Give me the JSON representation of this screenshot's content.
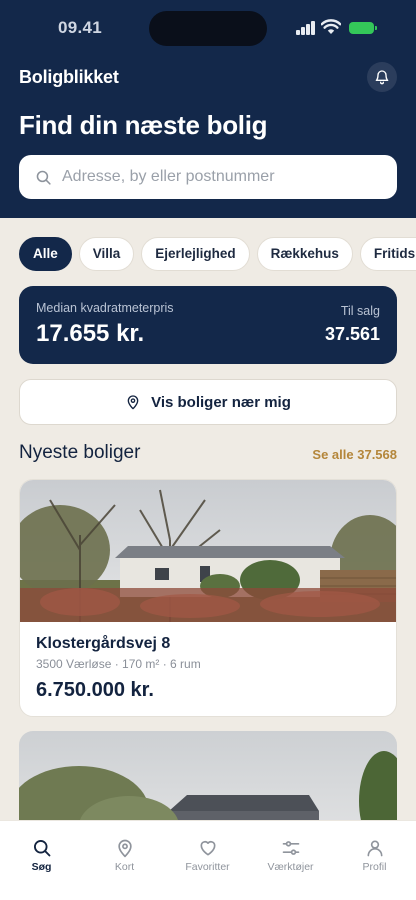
{
  "status_bar": {
    "time": "09.41"
  },
  "header": {
    "brand": "Boligblikket",
    "headline": "Find din næste bolig",
    "search_placeholder": "Adresse, by eller postnummer"
  },
  "filters": [
    {
      "label": "Alle",
      "active": true
    },
    {
      "label": "Villa",
      "active": false
    },
    {
      "label": "Ejerlejlighed",
      "active": false
    },
    {
      "label": "Rækkehus",
      "active": false
    },
    {
      "label": "Fritidshus",
      "active": false
    }
  ],
  "stats": {
    "median_label": "Median kvadratmeterpris",
    "median_value": "17.655 kr.",
    "for_sale_label": "Til salg",
    "for_sale_value": "37.561"
  },
  "near_me_label": "Vis boliger nær mig",
  "newest": {
    "title": "Nyeste boliger",
    "see_all": "Se alle 37.568"
  },
  "listings": [
    {
      "address": "Klostergårdsvej 8",
      "meta": "3500 Værløse · 170 m² · 6 rum",
      "price": "6.750.000 kr."
    }
  ],
  "tabs": [
    {
      "label": "Søg",
      "icon": "search-icon",
      "active": true
    },
    {
      "label": "Kort",
      "icon": "map-pin-icon",
      "active": false
    },
    {
      "label": "Favoritter",
      "icon": "heart-icon",
      "active": false
    },
    {
      "label": "Værktøjer",
      "icon": "sliders-icon",
      "active": false
    },
    {
      "label": "Profil",
      "icon": "user-icon",
      "active": false
    }
  ],
  "colors": {
    "navy": "#13284a",
    "background": "#efebe4",
    "accent_gold": "#b4863a",
    "battery_green": "#34c759"
  }
}
